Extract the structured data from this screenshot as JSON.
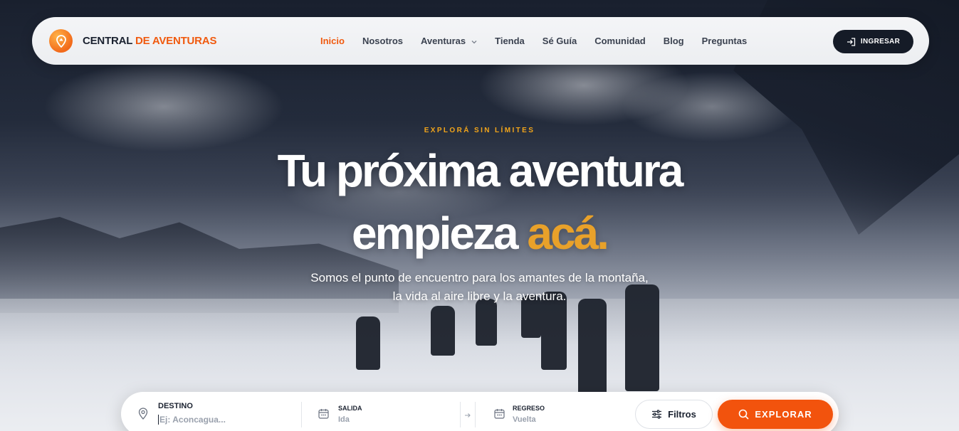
{
  "brand": {
    "name_part1": "CENTRAL",
    "name_part2": "DE AVENTURAS",
    "accent_color": "#f05a0f"
  },
  "nav": {
    "items": [
      {
        "label": "Inicio",
        "active": true
      },
      {
        "label": "Nosotros"
      },
      {
        "label": "Aventuras",
        "has_dropdown": true
      },
      {
        "label": "Tienda"
      },
      {
        "label": "Sé Guía"
      },
      {
        "label": "Comunidad"
      },
      {
        "label": "Blog"
      },
      {
        "label": "Preguntas"
      }
    ],
    "login_label": "INGRESAR",
    "login_icon": "login-icon"
  },
  "hero": {
    "eyebrow": "EXPLORÁ SIN LÍMITES",
    "headline_line1": "Tu próxima aventura",
    "headline_line2": "empieza",
    "headline_accent": "acá.",
    "subtitle_line1": "Somos el punto de encuentro para los amantes de la montaña,",
    "subtitle_line2": "la vida al aire libre y la aventura.",
    "accent_color": "#e8a12a"
  },
  "search": {
    "destination": {
      "label": "DESTINO",
      "placeholder": "Ej: Aconcagua...",
      "icon": "location-pin-icon"
    },
    "departure": {
      "label": "SALIDA",
      "value": "Ida",
      "icon": "calendar-icon"
    },
    "return": {
      "label": "REGRESO",
      "value": "Vuelta",
      "icon": "calendar-icon"
    },
    "filters_label": "Filtros",
    "explore_label": "EXPLORAR",
    "explore_color": "#f2530d"
  }
}
